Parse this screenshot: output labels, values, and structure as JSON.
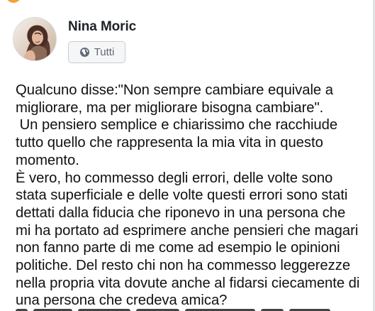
{
  "author": {
    "name": "Nina Moric"
  },
  "privacy": {
    "label": "Tutti",
    "icon": "globe-icon"
  },
  "post": {
    "lines": [
      "Qualcuno disse:\"Non sempre cambiare equivale a",
      "migliorare, ma per migliorare bisogna cambiare\".",
      " Un pensiero semplice e chiarissimo che racchiude",
      "tutto quello che rappresenta la mia vita in questo",
      "momento.",
      "È vero, ho commesso degli errori, delle volte sono",
      "stata superficiale e delle volte questi errori sono stati",
      "dettati dalla fiducia che riponevo in una persona che",
      "mi ha portato ad esprimere anche pensieri che magari",
      "non fanno parte di me come ad esempio le opinioni",
      "politiche. Del resto chi non ha commesso leggerezze",
      "nella propria vita dovute anche al fidarsi ciecamente di",
      "una persona che credeva amica?"
    ]
  },
  "colors": {
    "name": "#1d2129",
    "text": "#111111",
    "pill_background": "#f5f6f7",
    "pill_border": "#c9ccd1",
    "pill_text": "#5f6673",
    "accent": "#f2a23a"
  }
}
